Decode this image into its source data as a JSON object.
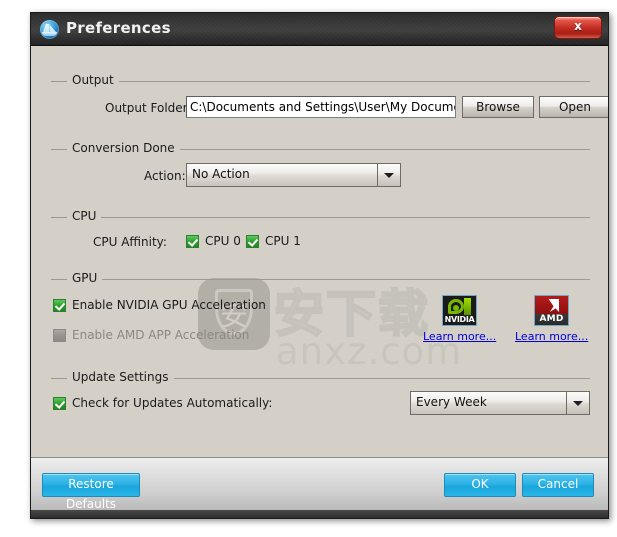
{
  "window": {
    "title": "Preferences",
    "app_icon": "app-logo-icon",
    "close_label": "x"
  },
  "groups": {
    "output": {
      "legend": "Output",
      "folder_label": "Output Folder:",
      "folder_value": "C:\\Documents and Settings\\User\\My Documents\\Aisee",
      "browse_label": "Browse",
      "open_label": "Open"
    },
    "conversion_done": {
      "legend": "Conversion Done",
      "action_label": "Action:",
      "action_value": "No Action"
    },
    "cpu": {
      "legend": "CPU",
      "affinity_label": "CPU Affinity:",
      "cpu0_label": "CPU 0",
      "cpu1_label": "CPU 1"
    },
    "gpu": {
      "legend": "GPU",
      "nvidia_label": "Enable NVIDIA GPU Acceleration",
      "amd_label": "Enable AMD APP Acceleration",
      "nvidia_logo_word": "NVIDIA",
      "amd_logo_word": "AMD",
      "nvidia_learn_more": "Learn more...",
      "amd_learn_more": "Learn more..."
    },
    "update_settings": {
      "legend": "Update Settings",
      "check_label": "Check for Updates Automatically:",
      "frequency_value": "Every Week"
    }
  },
  "footer": {
    "restore_label": "Restore Defaults",
    "ok_label": "OK",
    "cancel_label": "Cancel"
  },
  "watermark": {
    "chinese": "安下载",
    "domain": "anxz.com"
  },
  "colors": {
    "accent_blue": "#29b6e8",
    "dialog_bg": "#d4d0c8",
    "titlebar": "#333333",
    "close_red": "#c02a20",
    "link_blue": "#0000d8",
    "check_green": "#2d9c2d",
    "nvidia_green": "#76b900",
    "amd_red": "#b51b1b"
  }
}
